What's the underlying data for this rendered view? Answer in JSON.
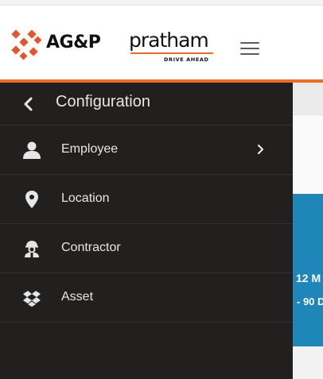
{
  "header": {
    "logo": {
      "brand": "AG&P",
      "product": "pratham",
      "tagline": "DRIVE AHEAD",
      "icon": "agp-x-logo-icon"
    },
    "menu_icon": "hamburger-menu-icon"
  },
  "sidebar": {
    "back_icon": "chevron-left-icon",
    "title": "Configuration",
    "items": [
      {
        "label": "Employee",
        "icon": "user-icon",
        "has_submenu": true
      },
      {
        "label": "Location",
        "icon": "map-marker-icon",
        "has_submenu": false
      },
      {
        "label": "Contractor",
        "icon": "worker-helmet-icon",
        "has_submenu": false
      },
      {
        "label": "Asset",
        "icon": "dropbox-icon",
        "has_submenu": false
      }
    ]
  },
  "background_card": {
    "line1": "12 M",
    "line2": "- 90 D"
  },
  "colors": {
    "accent_orange": "#f26b21",
    "sidebar_bg": "#221f1f",
    "sidebar_text": "#e6e6e6",
    "card_blue": "#1f86b9"
  }
}
